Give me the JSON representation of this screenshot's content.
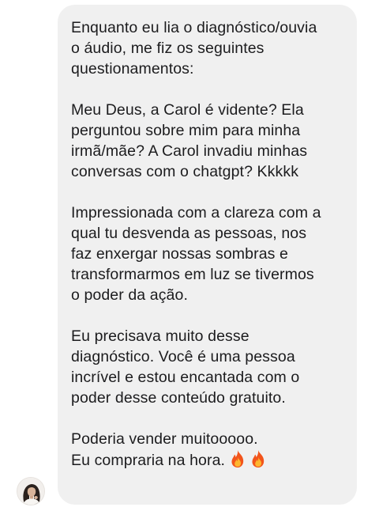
{
  "message": {
    "paragraph_1": "Enquanto eu lia o diagnóstico/ouvia\no áudio, me fiz os seguintes\nquestionamentos:",
    "paragraph_2": "Meu Deus, a Carol é vidente? Ela\nperguntou sobre mim para minha\nirmã/mãe? A Carol invadiu minhas\nconversas com o chatgpt? Kkkkk",
    "paragraph_3": "Impressionada com a clareza com a\nqual tu desvenda as pessoas, nos\nfaz enxergar nossas sombras e\ntransformarmos em luz se tivermos\no poder da ação.",
    "paragraph_4": "Eu precisava muito desse\ndiagnóstico. Você é uma pessoa\nincrível e estou encantada com o\npoder desse conteúdo gratuito.",
    "paragraph_5_line_1": "Poderia vender muitooooo.",
    "paragraph_5_line_2": "Eu compraria na hora.",
    "emojis": [
      "fire-icon",
      "fire-icon"
    ]
  },
  "colors": {
    "bubble_background": "#f0f0f0",
    "text": "#1c1c1e",
    "page_background": "#ffffff"
  }
}
